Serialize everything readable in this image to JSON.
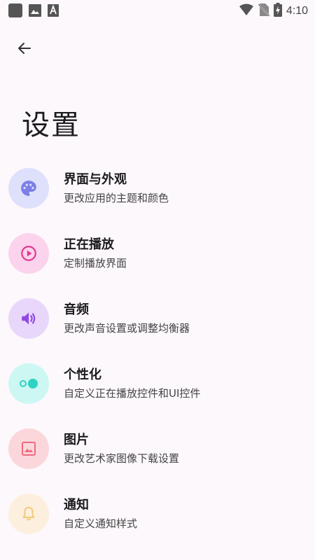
{
  "status_bar": {
    "time": "4:10",
    "left_icons": [
      "square-app-icon",
      "image-icon",
      "a-badge-icon"
    ],
    "right_icons": [
      "wifi-icon",
      "no-sim-icon",
      "battery-charging-icon"
    ]
  },
  "header": {
    "back_icon": "arrow-left-icon",
    "title": "设置"
  },
  "items": [
    {
      "title": "界面与外观",
      "subtitle": "更改应用的主题和颜色",
      "icon": "palette-icon",
      "icon_bg": "#dfe0fb",
      "icon_color": "#7b7fe6"
    },
    {
      "title": "正在播放",
      "subtitle": "定制播放界面",
      "icon": "play-circle-icon",
      "icon_bg": "#fbd3ec",
      "icon_color": "#e0388f"
    },
    {
      "title": "音频",
      "subtitle": "更改声音设置或调整均衡器",
      "icon": "volume-icon",
      "icon_bg": "#e8d7fb",
      "icon_color": "#8f49e6"
    },
    {
      "title": "个性化",
      "subtitle": "自定义正在播放控件和UI控件",
      "icon": "toggle-icon",
      "icon_bg": "#cdf7f3",
      "icon_color": "#2fd3c4"
    },
    {
      "title": "图片",
      "subtitle": "更改艺术家图像下载设置",
      "icon": "image-icon",
      "icon_bg": "#fbd7dc",
      "icon_color": "#ef6a7e"
    },
    {
      "title": "通知",
      "subtitle": "自定义通知样式",
      "icon": "bell-icon",
      "icon_bg": "#fcefdd",
      "icon_color": "#f3c978"
    }
  ]
}
